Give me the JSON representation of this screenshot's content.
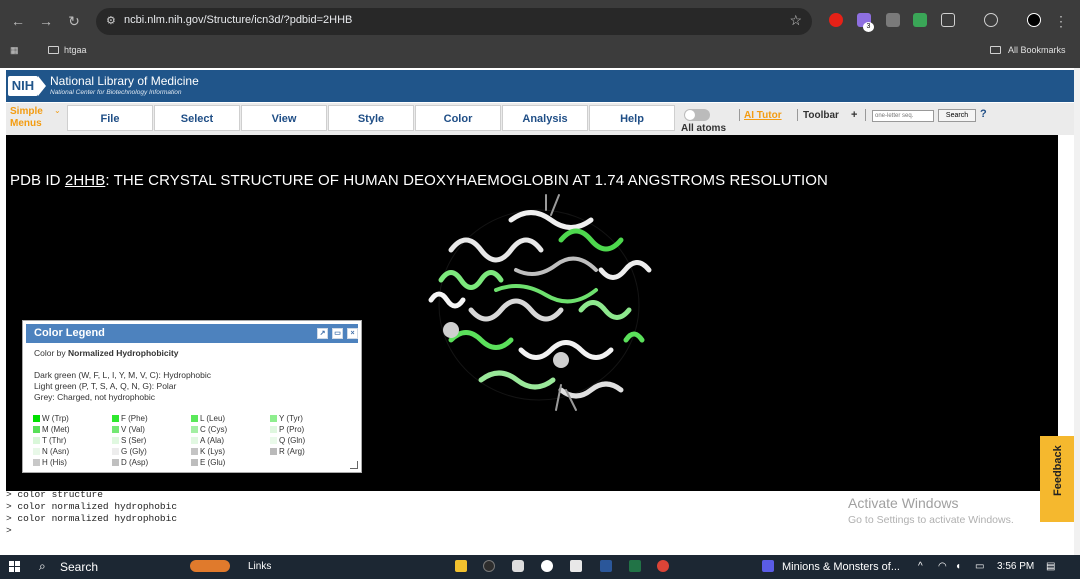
{
  "browser": {
    "url": "ncbi.nlm.nih.gov/Structure/icn3d/?pdbid=2HHB",
    "bookmark_folder": "htgaa",
    "all_bookmarks": "All Bookmarks",
    "ext_badge": "3"
  },
  "header": {
    "logo": "NIH",
    "title": "National Library of Medicine",
    "subtitle": "National Center for Biotechnology Information"
  },
  "menu": {
    "simple_menus": "Simple\nMenus",
    "items": [
      "File",
      "Select",
      "View",
      "Style",
      "Color",
      "Analysis",
      "Help"
    ],
    "all_atoms": "All atoms",
    "ai_tutor": "AI Tutor",
    "toolbar": "Toolbar",
    "toolbar_plus": "+",
    "seq_placeholder": "one-letter seq.",
    "search": "Search",
    "help_q": "?"
  },
  "viewer": {
    "pdb_prefix": "PDB ID ",
    "pdb_id": "2HHB",
    "pdb_title": ": THE CRYSTAL STRUCTURE OF HUMAN DEOXYHAEMOGLOBIN AT 1.74 ANGSTROMS RESOLUTION"
  },
  "legend": {
    "title": "Color Legend",
    "color_by_prefix": "Color by ",
    "color_by": "Normalized Hydrophobicity",
    "line1": "Dark green (W, F, L, I, Y, M, V, C): Hydrophobic",
    "line2": "Light green (P, T, S, A, Q, N, G): Polar",
    "line3": "Grey: Charged, not hydrophobic",
    "col1": [
      {
        "label": "W (Trp)",
        "color": "#00e000"
      },
      {
        "label": "M (Met)",
        "color": "#57e057"
      },
      {
        "label": "T (Thr)",
        "color": "#d9f7d9"
      },
      {
        "label": "N (Asn)",
        "color": "#e8f8e8"
      },
      {
        "label": "H (His)",
        "color": "#c8c8c8"
      }
    ],
    "col2": [
      {
        "label": "F (Phe)",
        "color": "#2ee82e"
      },
      {
        "label": "V (Val)",
        "color": "#73e873"
      },
      {
        "label": "S (Ser)",
        "color": "#e0f8e0"
      },
      {
        "label": "G (Gly)",
        "color": "#ededed"
      },
      {
        "label": "D (Asp)",
        "color": "#c0c0c0"
      }
    ],
    "col3": [
      {
        "label": "L (Leu)",
        "color": "#5ae85a"
      },
      {
        "label": "C (Cys)",
        "color": "#a3efa3"
      },
      {
        "label": "A (Ala)",
        "color": "#e2f8e2"
      },
      {
        "label": "K (Lys)",
        "color": "#c4c4c4"
      },
      {
        "label": "E (Glu)",
        "color": "#bdbdbd"
      }
    ],
    "col4": [
      {
        "label": "Y (Tyr)",
        "color": "#8eee8e"
      },
      {
        "label": "P (Pro)",
        "color": "#dff7df"
      },
      {
        "label": "Q (Gln)",
        "color": "#eafaea"
      },
      {
        "label": "R (Arg)",
        "color": "#bababa"
      }
    ]
  },
  "console": {
    "lines": [
      "> color structure",
      "> color normalized hydrophobic",
      "> color normalized hydrophobic",
      ">"
    ]
  },
  "activate": {
    "line1": "Activate Windows",
    "line2": "Go to Settings to activate Windows."
  },
  "feedback": "Feedback",
  "taskbar": {
    "search": "Search",
    "links": "Links",
    "active_window": "Minions & Monsters of...",
    "time": "3:56 PM"
  }
}
